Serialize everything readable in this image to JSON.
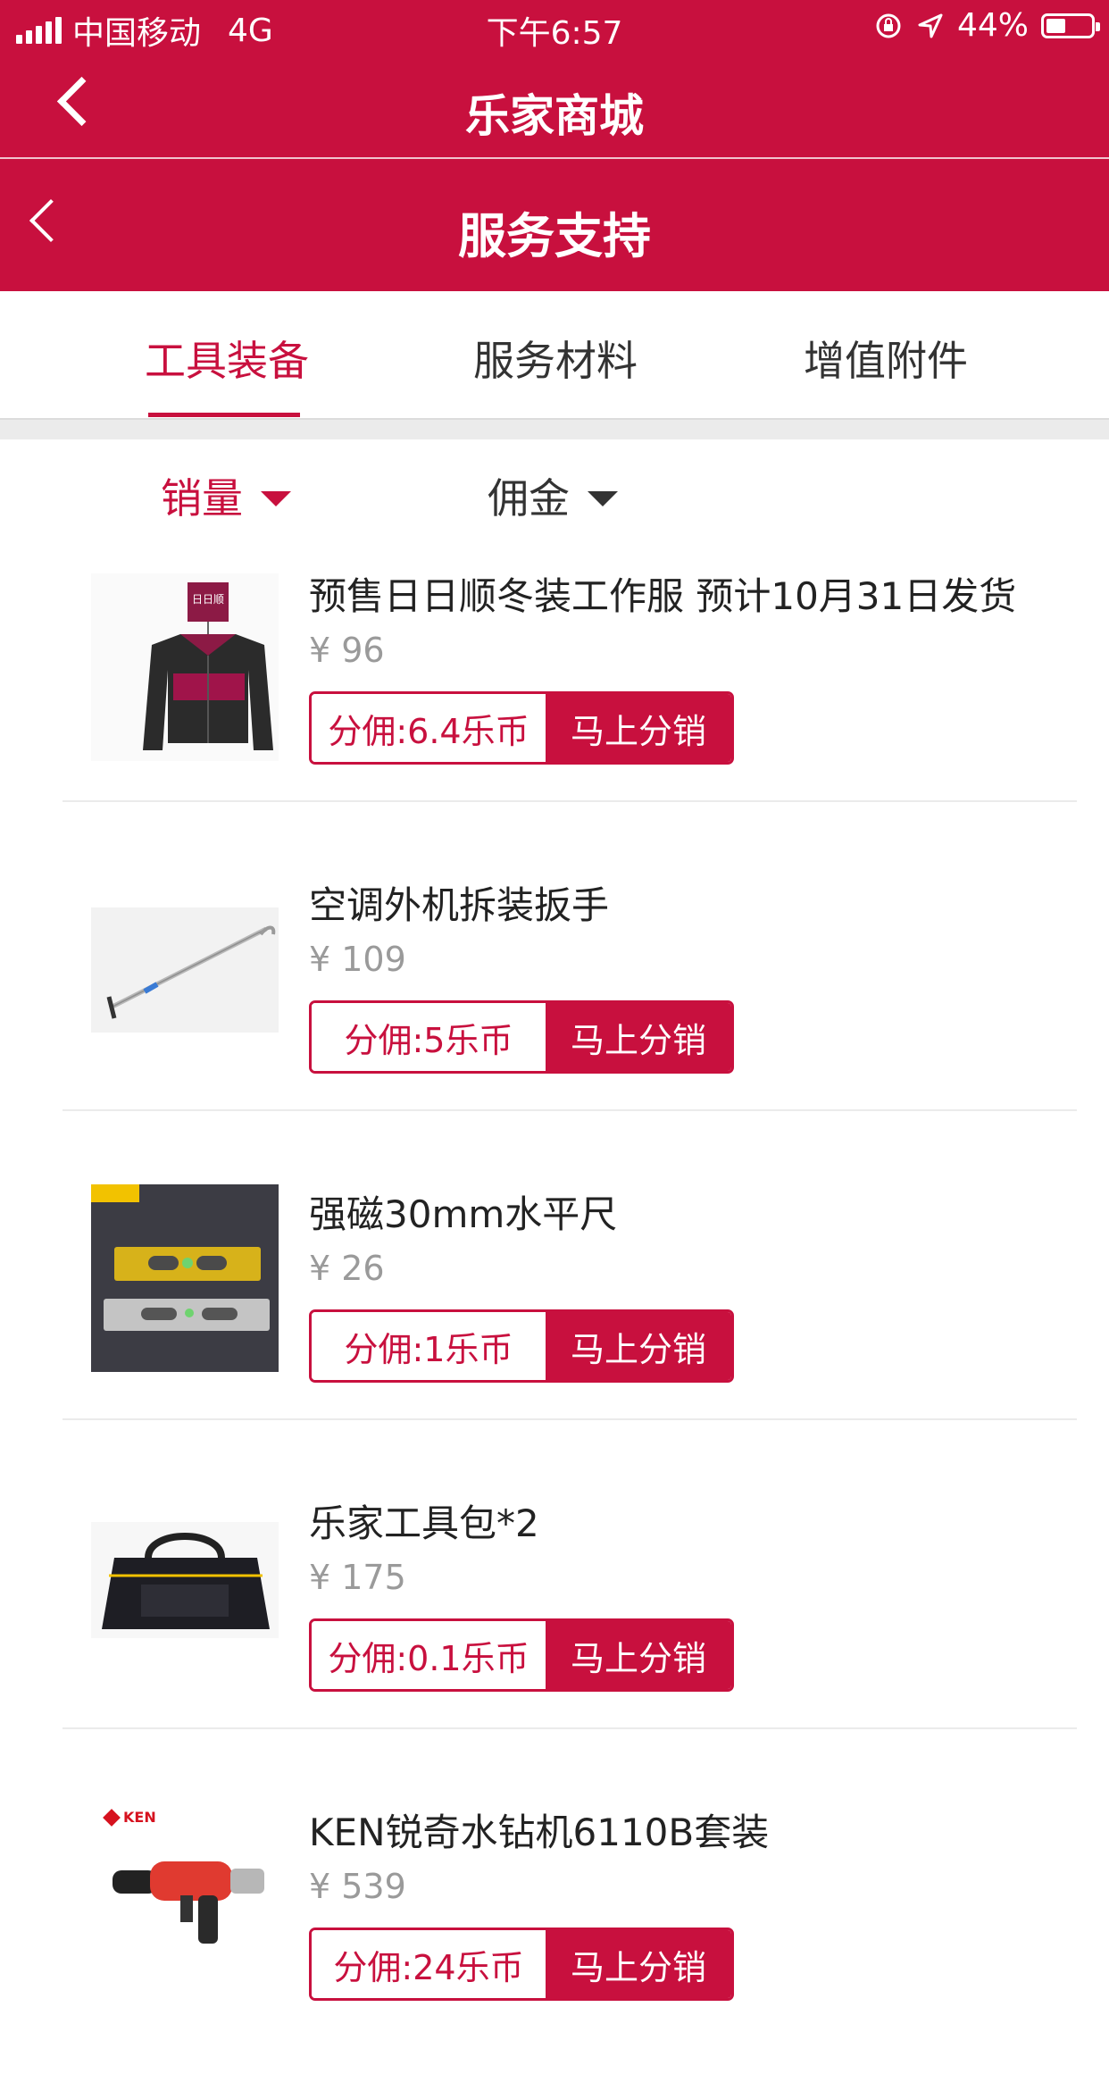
{
  "status_bar": {
    "carrier": "中国移动",
    "network": "4G",
    "time": "下午6:57",
    "battery": "44%",
    "battery_level": 0.44
  },
  "app_header": {
    "title": "乐家商城"
  },
  "page_header": {
    "title": "服务支持"
  },
  "tabs": [
    {
      "label": "工具装备",
      "active": true
    },
    {
      "label": "服务材料",
      "active": false
    },
    {
      "label": "增值附件",
      "active": false
    }
  ],
  "sort": [
    {
      "label": "销量",
      "active": true
    },
    {
      "label": "佣金",
      "active": false
    }
  ],
  "products": [
    {
      "name": "预售日日顺冬装工作服 预计10月31日发货",
      "price": "¥ 96",
      "commission": "分佣:6.4乐币",
      "action": "马上分销",
      "logo": "日日顺"
    },
    {
      "name": "空调外机拆装扳手",
      "price": "¥ 109",
      "commission": "分佣:5乐币",
      "action": "马上分销"
    },
    {
      "name": "强磁30mm水平尺",
      "price": "¥ 26",
      "commission": "分佣:1乐币",
      "action": "马上分销"
    },
    {
      "name": "乐家工具包*2",
      "price": "¥ 175",
      "commission": "分佣:0.1乐币",
      "action": "马上分销"
    },
    {
      "name": "KEN锐奇水钻机6110B套装",
      "price": "¥ 539",
      "commission": "分佣:24乐币",
      "action": "马上分销",
      "logo": "KEN"
    }
  ],
  "colors": {
    "brand": "#c8103e",
    "price": "#9a9a9a",
    "divider": "#ebebeb"
  }
}
